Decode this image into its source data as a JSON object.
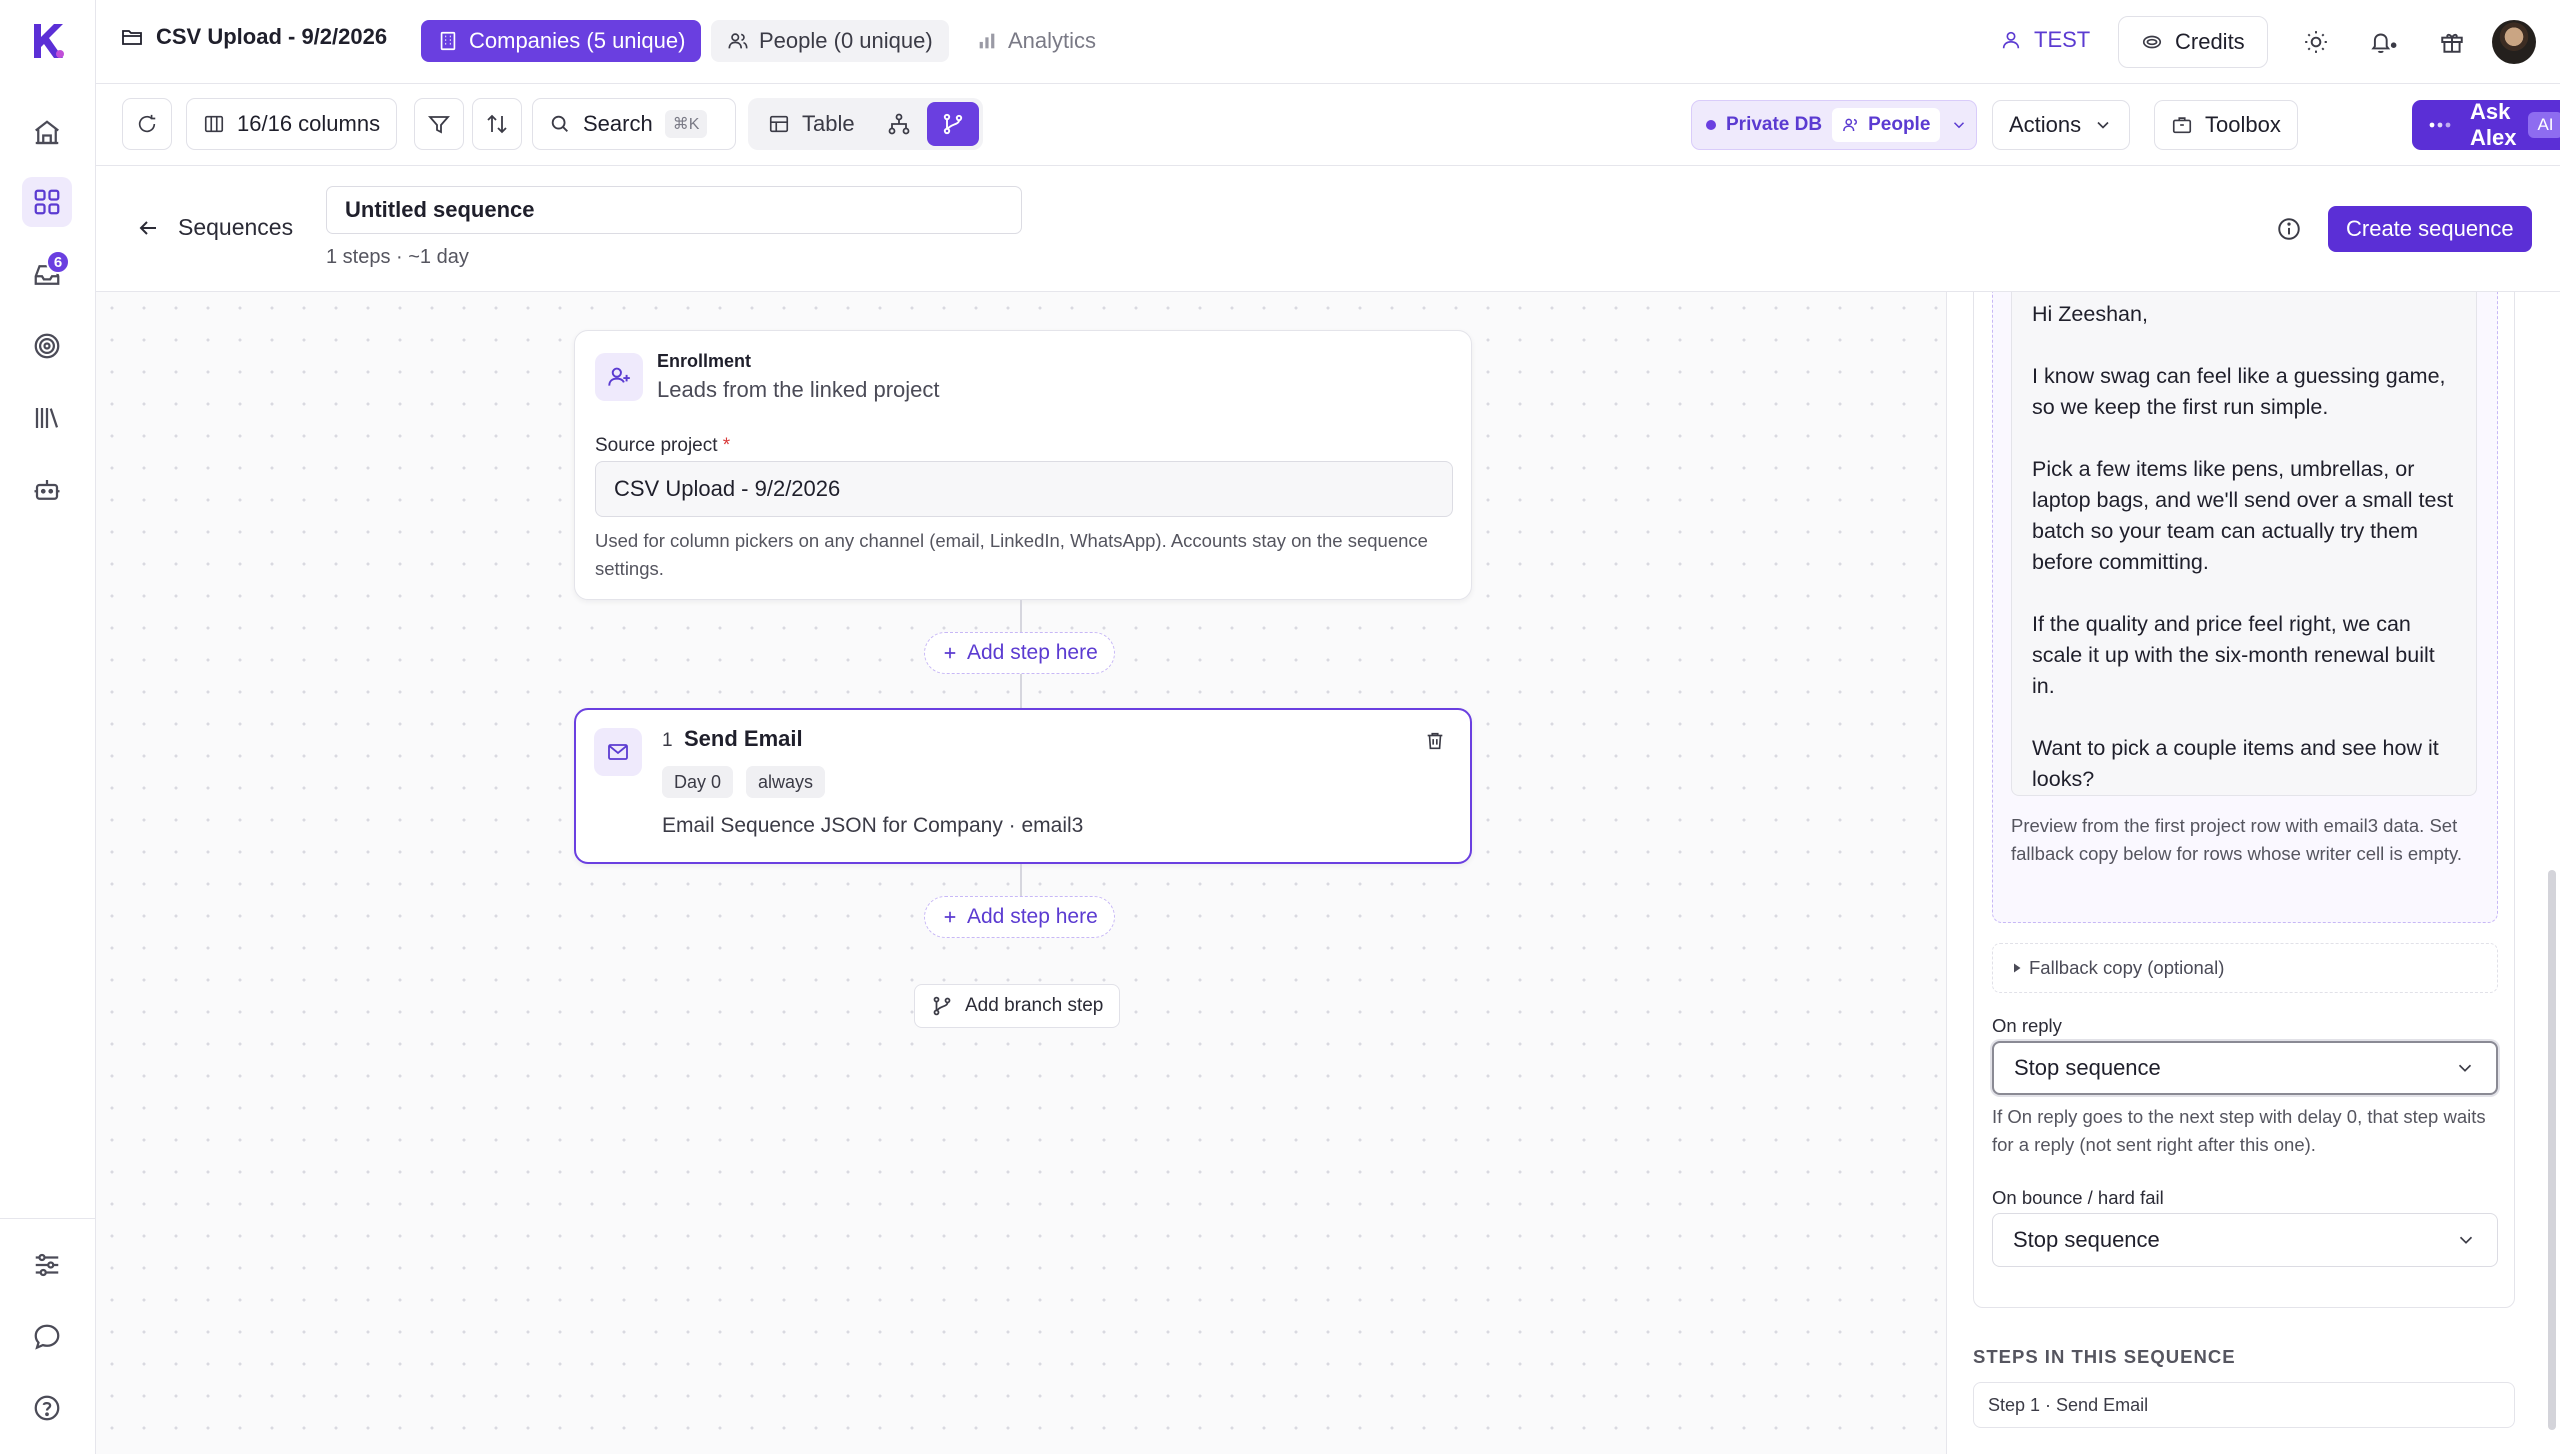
{
  "topbar": {
    "project_title": "CSV Upload - 9/2/2026",
    "tab_companies": "Companies (5 unique)",
    "tab_people": "People (0 unique)",
    "tab_analytics": "Analytics",
    "workspace": "TEST",
    "credits": "Credits"
  },
  "rail": {
    "inbox_badge": "6"
  },
  "toolbar": {
    "columns": "16/16 columns",
    "search": "Search",
    "search_shortcut": "⌘K",
    "view_table": "Table",
    "db_label": "Private DB",
    "db_entity": "People",
    "actions": "Actions",
    "toolbox": "Toolbox",
    "ask_alex": "Ask Alex",
    "ai_badge": "AI"
  },
  "sequence": {
    "back_label": "Sequences",
    "name": "Untitled sequence",
    "meta": "1 steps · ~1 day",
    "create_button": "Create sequence"
  },
  "enrollment": {
    "title": "Enrollment",
    "subtitle": "Leads from the linked project",
    "source_label": "Source project",
    "required_mark": "*",
    "source_value": "CSV Upload - 9/2/2026",
    "help": "Used for column pickers on any channel (email, LinkedIn, WhatsApp). Accounts stay on the sequence settings."
  },
  "add_step_label": "Add step here",
  "step1": {
    "number": "1",
    "title": "Send Email",
    "day_chip": "Day 0",
    "condition_chip": "always",
    "description": "Email Sequence JSON for Company · email3"
  },
  "add_branch_label": "Add branch step",
  "panel": {
    "preview_paragraphs": [
      "Hi Zeeshan,",
      "I know swag can feel like a guessing game, so we keep the first run simple.",
      "Pick a few items like pens, umbrellas, or laptop bags, and we'll send over a small test batch so your team can actually try them before committing.",
      "If the quality and price feel right, we can scale it up with the six-month renewal built in.",
      "Want to pick a couple items and see how it looks?"
    ],
    "preview_note": "Preview from the first project row with email3 data. Set fallback copy below for rows whose writer cell is empty.",
    "fallback": "Fallback copy (optional)",
    "on_reply_label": "On reply",
    "on_reply_value": "Stop sequence",
    "on_reply_help": "If On reply goes to the next step with delay 0, that step waits for a reply (not sent right after this one).",
    "on_bounce_label": "On bounce / hard fail",
    "on_bounce_value": "Stop sequence",
    "steps_heading": "STEPS IN THIS SEQUENCE",
    "steps": [
      "Step 1 · Send Email"
    ]
  },
  "colors": {
    "accent": "#6a3fe0",
    "accent_dark": "#5b2fd6",
    "accent_soft": "#efeafc"
  }
}
